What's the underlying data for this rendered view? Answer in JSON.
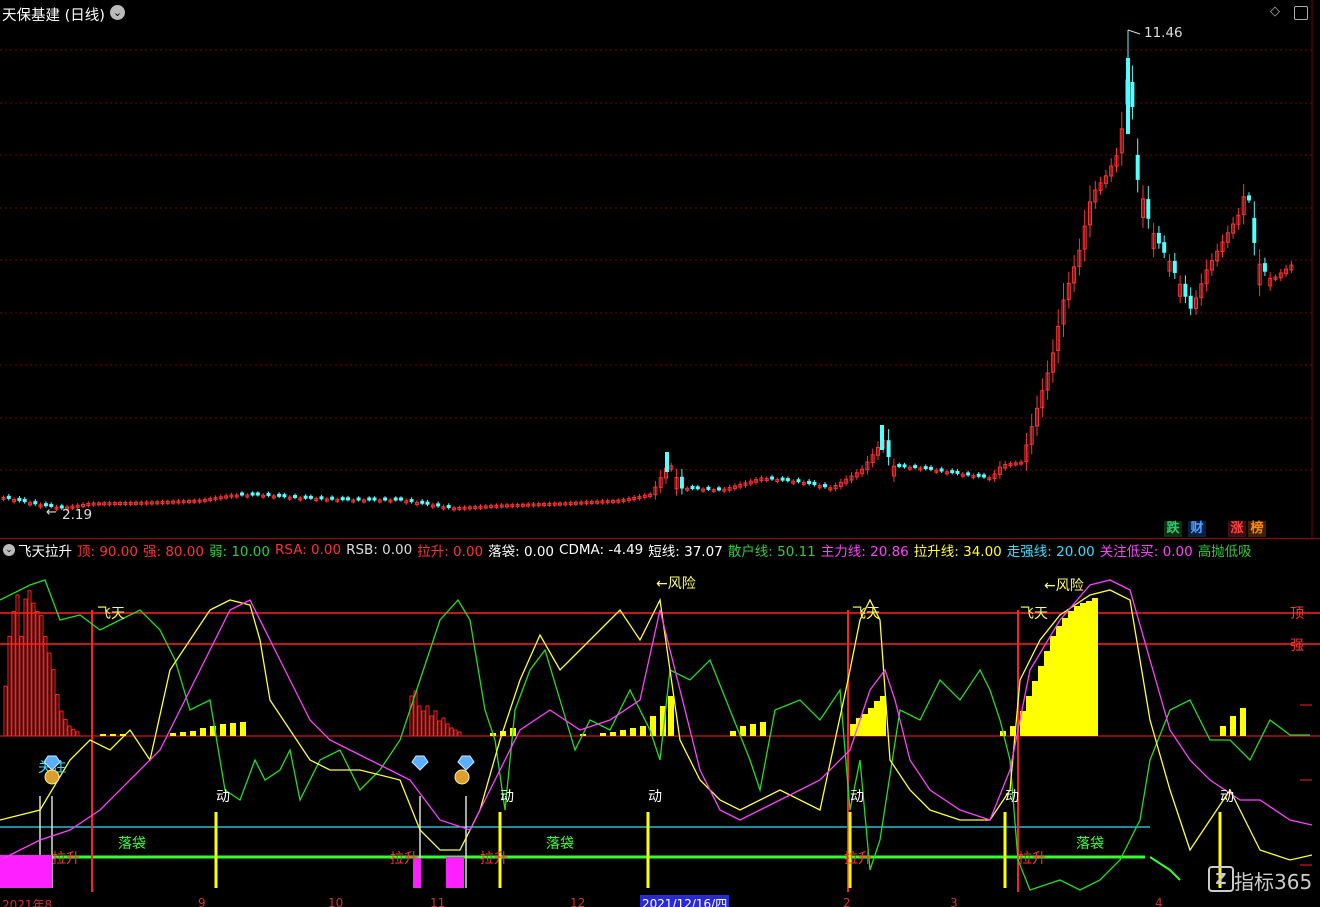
{
  "main_panel": {
    "title": "天保基建 (日线)",
    "high_price_label": "11.46",
    "low_price_label": "2.19",
    "bottom_badges": [
      {
        "label": "跌",
        "color": "#2ecc71"
      },
      {
        "label": "财",
        "color": "#4aa3ff"
      },
      {
        "label": "涨",
        "color": "#ff4040"
      },
      {
        "label": "榜",
        "color": "#ff8c00"
      }
    ],
    "colors": {
      "up": "#ff3232",
      "down": "#54ffff",
      "grid": "#7a0000"
    }
  },
  "indicator_panel": {
    "name": "飞天拉升",
    "params": [
      {
        "label": "顶:",
        "value": "90.00",
        "color": "#ff3232"
      },
      {
        "label": "强:",
        "value": "80.00",
        "color": "#ff3232"
      },
      {
        "label": "弱:",
        "value": "10.00",
        "color": "#2ecc40"
      },
      {
        "label": "RSA:",
        "value": "0.00",
        "color": "#ff3232"
      },
      {
        "label": "RSB:",
        "value": "0.00",
        "color": "#dddddd"
      },
      {
        "label": "拉升:",
        "value": "0.00",
        "color": "#ff3232"
      },
      {
        "label": "落袋:",
        "value": "0.00",
        "color": "#ffffff"
      },
      {
        "label": "CDMA:",
        "value": "-4.49",
        "color": "#ffffff"
      },
      {
        "label": "短线:",
        "value": "37.07",
        "color": "#ffffff"
      },
      {
        "label": "散户线:",
        "value": "50.11",
        "color": "#2ecc40"
      },
      {
        "label": "主力线:",
        "value": "20.86",
        "color": "#ff40ff"
      },
      {
        "label": "拉升线:",
        "value": "34.00",
        "color": "#ffff33"
      },
      {
        "label": "走强线:",
        "value": "20.00",
        "color": "#33e0ff"
      },
      {
        "label": "关注低买:",
        "value": "0.00",
        "color": "#ff40ff"
      },
      {
        "label": "高抛低吸",
        "value": "",
        "color": "#2ecc40"
      }
    ],
    "right_labels": {
      "top": "顶",
      "strong": "强"
    },
    "annotations": {
      "feitian": "飞天",
      "risk": "←风险",
      "move": "动",
      "profit_take": "落袋",
      "pull_up": "拉升",
      "attention": "关注"
    }
  },
  "x_axis": {
    "labels": [
      "2021年8",
      "9",
      "10",
      "11",
      "12",
      "2021/12/16/四",
      "2",
      "3",
      "4"
    ]
  },
  "watermark": "指标365"
}
